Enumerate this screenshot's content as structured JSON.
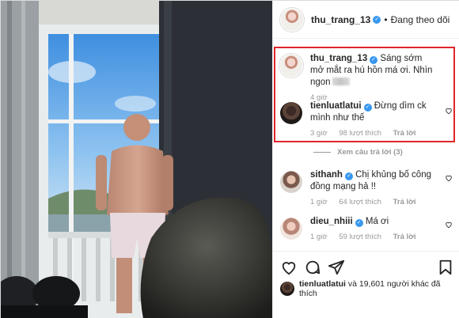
{
  "post": {
    "author": "thu_trang_13",
    "follow_status": "Đang theo dõi",
    "separator": "•"
  },
  "comments": [
    {
      "user": "thu_trang_13",
      "text": "Sáng sớm mở mắt ra hú hồn má ơi. Nhìn ngon",
      "time": "4 giờ"
    },
    {
      "user": "tienluatlatui",
      "text": "Đừng dìm ck mình như thế",
      "time": "3 giờ",
      "likes": "98 lượt thích",
      "reply": "Trả lời"
    },
    {
      "user": "sithanh",
      "text": "Chị khủng bố công đồng mạng hả !!",
      "time": "1 giờ",
      "likes": "64 lượt thích",
      "reply": "Trả lời"
    },
    {
      "user": "dieu_nhiii",
      "text": "Má ơi",
      "time": "1 giờ",
      "likes": "59 lượt thích",
      "reply": "Trả lời"
    }
  ],
  "view_replies": "Xem câu trả lời (3)",
  "liked_by": {
    "user": "tienluatlatui",
    "rest": "và 19,601 người khác đã thích"
  },
  "icons": [
    "heart-icon",
    "comment-icon",
    "share-icon",
    "bookmark-icon",
    "verified-badge-icon"
  ],
  "colors": {
    "highlight_box": "#e0262b",
    "verified": "#3897f0"
  }
}
